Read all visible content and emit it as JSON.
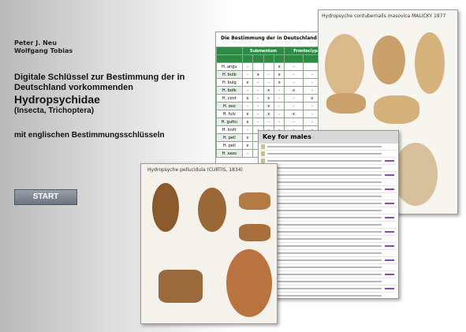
{
  "authors": [
    "Peter J. Neu",
    "Wolfgang Tobias"
  ],
  "title": {
    "line1": "Digitale Schlüssel zur Bestimmung der in Deutschland vorkommenden",
    "family": "Hydropsychidae",
    "taxon": "(Insecta, Trichoptera)",
    "subtitle": "mit englischen Bestimmungsschlüsseln"
  },
  "start_button": {
    "label": "START"
  },
  "screenshots": {
    "table": {
      "title": "Die Bestimmung der in Deutschland",
      "col_headers": [
        "Submentum",
        "Frontoclypeus"
      ],
      "rows": [
        "H. angu",
        "H. bulb",
        "H. bulg",
        "H. botk",
        "H. cont",
        "H. exo",
        "H. fulv",
        "H. guttu",
        "H. instr",
        "H. pell",
        "H. pell",
        "H. saxo"
      ]
    },
    "plate": {
      "title": "Hydropsyche contubernalis masovica MALICKY 1977"
    },
    "key": {
      "title": "Key for males"
    },
    "photo": {
      "title": "Hydropsyche pellucidula (CURTIS, 1834)"
    }
  }
}
